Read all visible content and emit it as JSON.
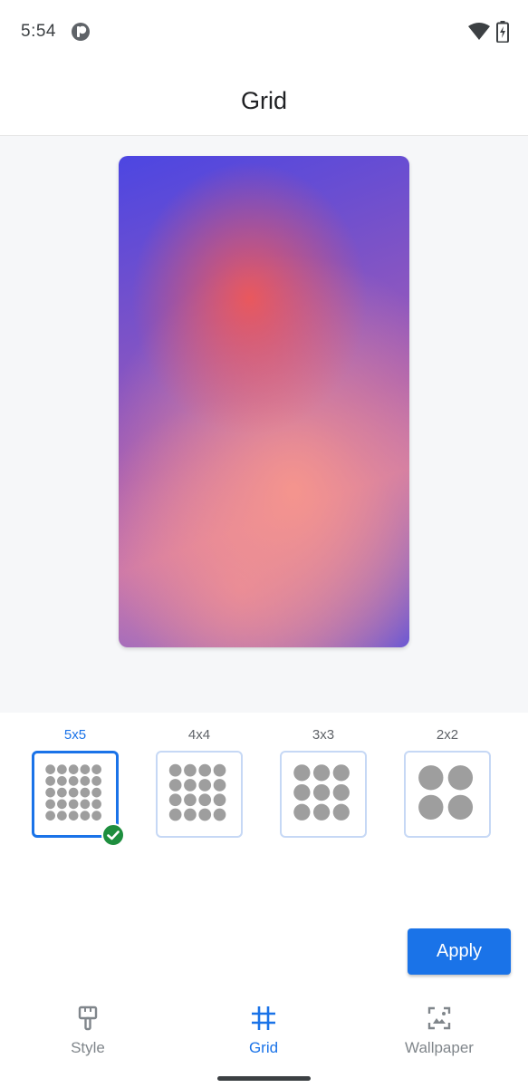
{
  "status_bar": {
    "time": "5:54",
    "icons": [
      "app-notification-icon",
      "wifi-icon",
      "battery-charging-icon"
    ]
  },
  "app_bar": {
    "title": "Grid"
  },
  "grid_options": [
    {
      "label": "5x5",
      "selected": true
    },
    {
      "label": "4x4",
      "selected": false
    },
    {
      "label": "3x3",
      "selected": false
    },
    {
      "label": "2x2",
      "selected": false
    }
  ],
  "apply_label": "Apply",
  "bottom_nav": {
    "items": [
      {
        "label": "Style",
        "icon": "paintbrush-icon",
        "active": false
      },
      {
        "label": "Grid",
        "icon": "grid-icon",
        "active": true
      },
      {
        "label": "Wallpaper",
        "icon": "wallpaper-icon",
        "active": false
      }
    ]
  },
  "colors": {
    "accent": "#1a73e8",
    "check_badge": "#1e8e3e",
    "dot": "#9e9e9e"
  }
}
